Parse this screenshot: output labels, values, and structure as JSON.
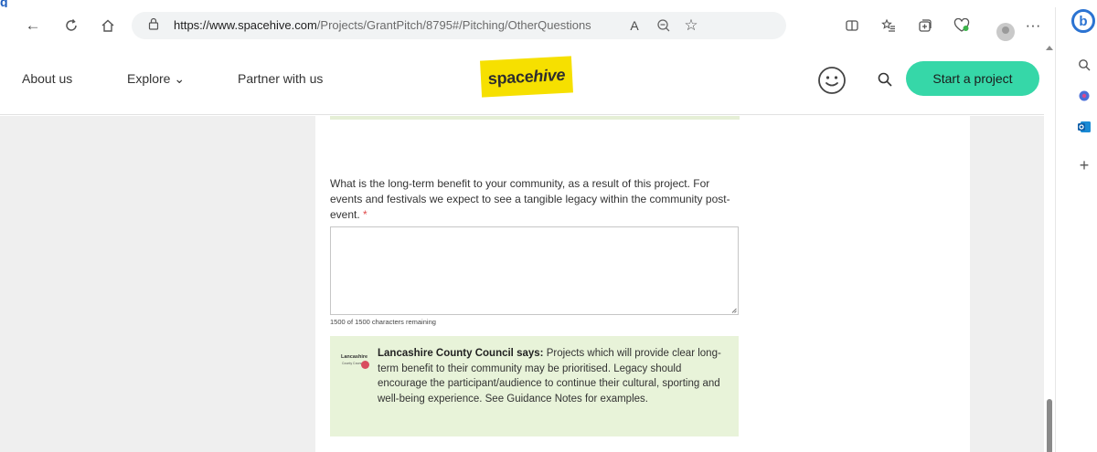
{
  "browser": {
    "url_host": "https://www.spacehive.com",
    "url_path": "/Projects/GrantPitch/8795#/Pitching/OtherQuestions"
  },
  "site": {
    "nav": {
      "about": "About us",
      "explore": "Explore ⌄",
      "partner": "Partner with us"
    },
    "logo_plain": "space",
    "logo_italic": "hive",
    "cta": "Start a project",
    "brand_color": "#36d7a8",
    "logo_color": "#f6e000"
  },
  "form": {
    "question": "What is the long-term benefit to your community, as a result of this project. For events and festivals we expect to see a tangible legacy within the community post-event.",
    "required_mark": "*",
    "answer_value": "",
    "counter": "1500 of 1500 characters remaining"
  },
  "council_note": {
    "logo_word": "Lancashire",
    "logo_sub": "County Council",
    "author": "Lancashire County Council says:",
    "text": " Projects which will provide clear long-term benefit to their community may be prioritised. Legacy should encourage the participant/audience to continue their cultural, sporting and well-being experience. See Guidance Notes for examples.",
    "background": "#e8f3d9"
  },
  "icons": {
    "back": "←",
    "refresh": "C",
    "home": "⌂",
    "lock": "🔒",
    "read_aloud": "A",
    "zoom": "⊖",
    "favorite": "☆",
    "split": "◫",
    "favorites_bar": "✩",
    "collections": "⊕",
    "health": "♡",
    "more": "···",
    "bing": "b",
    "side_search": "⚲",
    "side_add": "+"
  }
}
